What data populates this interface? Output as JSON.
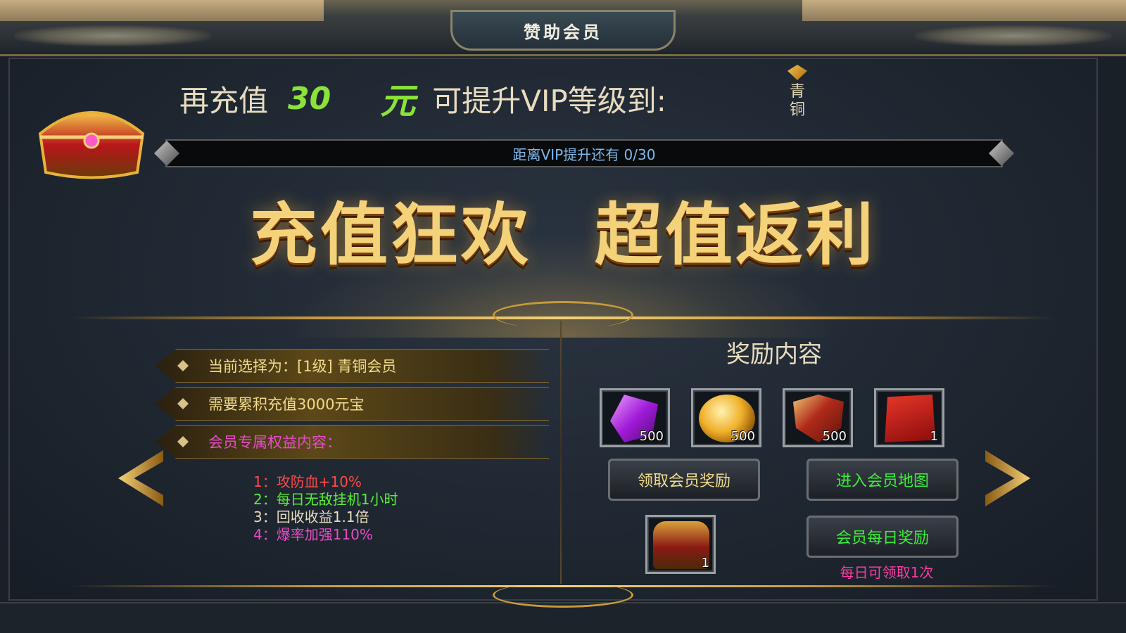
{
  "window": {
    "title": "赞助会员"
  },
  "recharge": {
    "prefix": "再充值",
    "amount": "30",
    "unit": "元",
    "suffix": "可提升VIP等级到:",
    "target_level": "青铜"
  },
  "progress": {
    "text": "距离VIP提升还有 0/30",
    "current": 0,
    "max": 30
  },
  "banner": {
    "left": "充值狂欢",
    "right": "超值返利"
  },
  "info": {
    "selected": "当前选择为：[1级] 青铜会员",
    "requirement": "需要累积充值3000元宝",
    "perks_title": "会员专属权益内容："
  },
  "perks": [
    {
      "text": "1：攻防血+10%",
      "color": "#ff4a4a"
    },
    {
      "text": "2：每日无敌挂机1小时",
      "color": "#5aee3a"
    },
    {
      "text": "3：回收收益1.1倍",
      "color": "#e8dcc0"
    },
    {
      "text": "4：爆率加强110%",
      "color": "#e84cc8"
    }
  ],
  "rewards": {
    "title": "奖励内容",
    "items": [
      {
        "icon": "purple-gem-icon",
        "qty": "500"
      },
      {
        "icon": "gold-coin-icon",
        "qty": "500"
      },
      {
        "icon": "shield-badge-icon",
        "qty": "500"
      },
      {
        "icon": "red-envelope-icon",
        "qty": "1"
      }
    ],
    "daily_chest": {
      "icon": "treasure-chest-icon",
      "qty": "1"
    }
  },
  "buttons": {
    "claim": "领取会员奖励",
    "enter_map": "进入会员地图",
    "daily": "会员每日奖励"
  },
  "daily_note": "每日可领取1次",
  "colors": {
    "gold_text": "#f2dc8a",
    "green_text": "#3aee3a",
    "pink_text": "#ff3aa8",
    "progress_text": "#7fb8ea"
  }
}
